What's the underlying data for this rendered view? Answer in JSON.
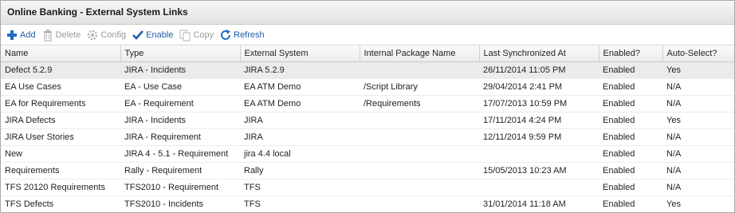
{
  "title": "Online Banking - External System Links",
  "toolbar": {
    "add": "Add",
    "delete": "Delete",
    "config": "Config",
    "enable": "Enable",
    "copy": "Copy",
    "refresh": "Refresh"
  },
  "columns": [
    "Name",
    "Type",
    "External System",
    "Internal Package Name",
    "Last Synchronized At",
    "Enabled?",
    "Auto-Select?"
  ],
  "rows": [
    [
      "Defect 5.2.9",
      "JIRA - Incidents",
      "JIRA 5.2.9",
      "",
      "26/11/2014 11:05 PM",
      "Enabled",
      "Yes"
    ],
    [
      "EA Use Cases",
      "EA - Use Case",
      "EA ATM Demo",
      "/Script Library",
      "29/04/2014 2:41 PM",
      "Enabled",
      "N/A"
    ],
    [
      "EA for Requirements",
      "EA - Requirement",
      "EA ATM Demo",
      "/Requirements",
      "17/07/2013 10:59 PM",
      "Enabled",
      "N/A"
    ],
    [
      "JIRA Defects",
      "JIRA - Incidents",
      "JIRA",
      "",
      "17/11/2014 4:24 PM",
      "Enabled",
      "Yes"
    ],
    [
      "JIRA User Stories",
      "JIRA - Requirement",
      "JIRA",
      "",
      "12/11/2014 9:59 PM",
      "Enabled",
      "N/A"
    ],
    [
      "New",
      "JIRA 4 - 5.1 - Requirement",
      "jira 4.4 local",
      "",
      "",
      "Enabled",
      "N/A"
    ],
    [
      "Requirements",
      "Rally - Requirement",
      "Rally",
      "",
      "15/05/2013 10:23 AM",
      "Enabled",
      "N/A"
    ],
    [
      "TFS 20120 Requirements",
      "TFS2010 - Requirement",
      "TFS",
      "",
      "",
      "Enabled",
      "N/A"
    ],
    [
      "TFS Defects",
      "TFS2010 - Incidents",
      "TFS",
      "",
      "31/01/2014 11:18 AM",
      "Enabled",
      "Yes"
    ]
  ],
  "colors": {
    "accent": "#1f5fa8",
    "disabled": "#9a9a9a",
    "selected_row": "#ebebeb"
  }
}
